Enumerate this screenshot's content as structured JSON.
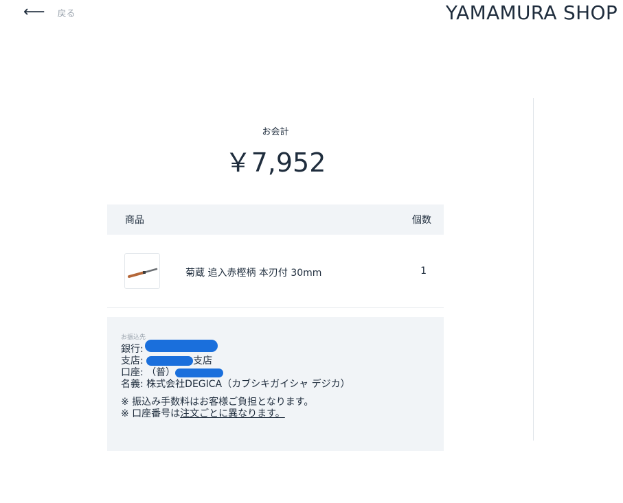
{
  "header": {
    "back_label": "戻る",
    "shop_name": "YAMAMURA SHOP"
  },
  "summary": {
    "total_label": "お会計",
    "total_amount": "￥7,952"
  },
  "items_table": {
    "columns": [
      "商品",
      "個数"
    ],
    "rows": [
      {
        "name": "菊蔵 追入赤樫柄 本刃付 30mm",
        "quantity": "1"
      }
    ]
  },
  "bank_transfer": {
    "title": "お振込先",
    "bank_label": "銀行:",
    "branch_label": "支店:",
    "branch_suffix": "支店",
    "account_label": "口座:",
    "account_type": "（普）",
    "holder_label": "名義:",
    "holder_value": "株式会社DEGICA（カブシキガイシャ デジカ）",
    "note1": "※ 振込み手数料はお客様ご負担となります。",
    "note2_prefix": "※ 口座番号は",
    "note2_underlined": "注文ごとに異なります。"
  },
  "colors": {
    "text": "#1f2d3d",
    "muted": "#9aa3ad",
    "panel_bg": "#f1f4f7",
    "redaction": "#1a6fdc"
  }
}
